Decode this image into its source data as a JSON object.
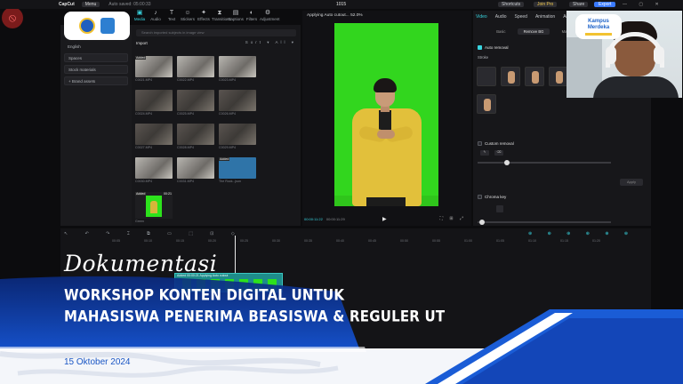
{
  "topbar": {
    "app_name": "CapCut",
    "menu_label": "Menu",
    "autosave": "Auto saved: 05:00:33",
    "project_title": "1015",
    "shortcuts_label": "Shortcuts",
    "joinpro_label": "Join Pro",
    "share_label": "Share",
    "export_label": "Export",
    "window_controls": "— ▢ ✕"
  },
  "toolbar": {
    "items": [
      {
        "icon": "media-icon",
        "glyph": "▣",
        "label": "Media"
      },
      {
        "icon": "audio-icon",
        "glyph": "♪",
        "label": "Audio"
      },
      {
        "icon": "text-icon",
        "glyph": "T",
        "label": "Text"
      },
      {
        "icon": "stickers-icon",
        "glyph": "☺",
        "label": "Stickers"
      },
      {
        "icon": "effects-icon",
        "glyph": "✦",
        "label": "Effects"
      },
      {
        "icon": "transitions-icon",
        "glyph": "⧗",
        "label": "Transitions"
      },
      {
        "icon": "captions-icon",
        "glyph": "▤",
        "label": "Captions"
      },
      {
        "icon": "filters-icon",
        "glyph": "◐",
        "label": "Filters"
      },
      {
        "icon": "adjustment-icon",
        "glyph": "⚙",
        "label": "Adjustment"
      }
    ]
  },
  "leftnav": {
    "items": [
      "English",
      "Spaces",
      "Stock materials",
      "+ Brand assets"
    ]
  },
  "media": {
    "search_placeholder": "Search imported subjects in image view",
    "import_label": "Import",
    "sort_label": "Sort  ▾   All  ▾",
    "thumbs": [
      {
        "label": "C0021.MP4",
        "badge": "Added",
        "style": "room"
      },
      {
        "label": "C0022.MP4",
        "badge": "",
        "style": "room"
      },
      {
        "label": "C0023.MP4",
        "badge": "",
        "style": "room"
      },
      {
        "label": "C0024.MP4",
        "badge": "",
        "style": "dark"
      },
      {
        "label": "C0025.MP4",
        "badge": "",
        "style": "dark"
      },
      {
        "label": "C0026.MP4",
        "badge": "",
        "style": "dark"
      },
      {
        "label": "C0027.MP4",
        "badge": "",
        "style": "dark"
      },
      {
        "label": "C0028.MP4",
        "badge": "",
        "style": "dark"
      },
      {
        "label": "C0029.MP4",
        "badge": "",
        "style": "dark"
      },
      {
        "label": "C0030.MP4",
        "badge": "",
        "style": "room"
      },
      {
        "label": "C0031.MP4",
        "badge": "",
        "style": "room"
      },
      {
        "label": "The Rock...json",
        "badge": "Added",
        "style": "blue"
      }
    ],
    "green_badge": "Added",
    "green_time": "00:21",
    "green_label": "Green"
  },
  "player": {
    "status": "Applying Auto cutout... 52.0%",
    "timecode": "00:00:11:22",
    "duration": "00:00:11:29",
    "play_glyph": "▶",
    "controls": "⛶ ⊞ ⤢"
  },
  "inspector": {
    "tabs": [
      "Video",
      "Audio",
      "Speed",
      "Animation",
      "Adjust"
    ],
    "subtabs": [
      "Basic",
      "Remove BG",
      "Mask"
    ],
    "auto_removal": "Auto removal",
    "stroke": "Stroke",
    "custom_removal": "Custom removal",
    "chroma_key": "Chroma key",
    "apply": "Apply"
  },
  "webcam": {
    "badge_title": "Kampus Merdeka"
  },
  "timeline": {
    "tools_left": "↖ ↶ ↷ ⌶ ⧉ ▭ ⬚ ⊡ ◇",
    "tools_right": "⊕ ⊕ ⊕ ⊕ ⊕ ⊕",
    "ruler": [
      "00:05",
      "00:10",
      "00:15",
      "00:20",
      "00:25",
      "00:30",
      "00:35",
      "00:40",
      "00:45",
      "00:50",
      "00:55",
      "01:00",
      "01:05",
      "01:10",
      "01:15",
      "01:20"
    ],
    "clip_label": "Added  00:00:21   Applying Auto cutout"
  },
  "banner": {
    "doc_label": "Dokumentasi",
    "title_line1": "WORKSHOP KONTEN DIGITAL UNTUK",
    "title_line2": "MAHASISWA PENERIMA BEASISWA & REGULER UT",
    "date": "15 Oktober 2024"
  },
  "colors": {
    "accent_cyan": "#38d5e0",
    "banner_blue": "#1550c8",
    "banner_dark": "#0c2f86",
    "green_screen": "#32d61e"
  }
}
